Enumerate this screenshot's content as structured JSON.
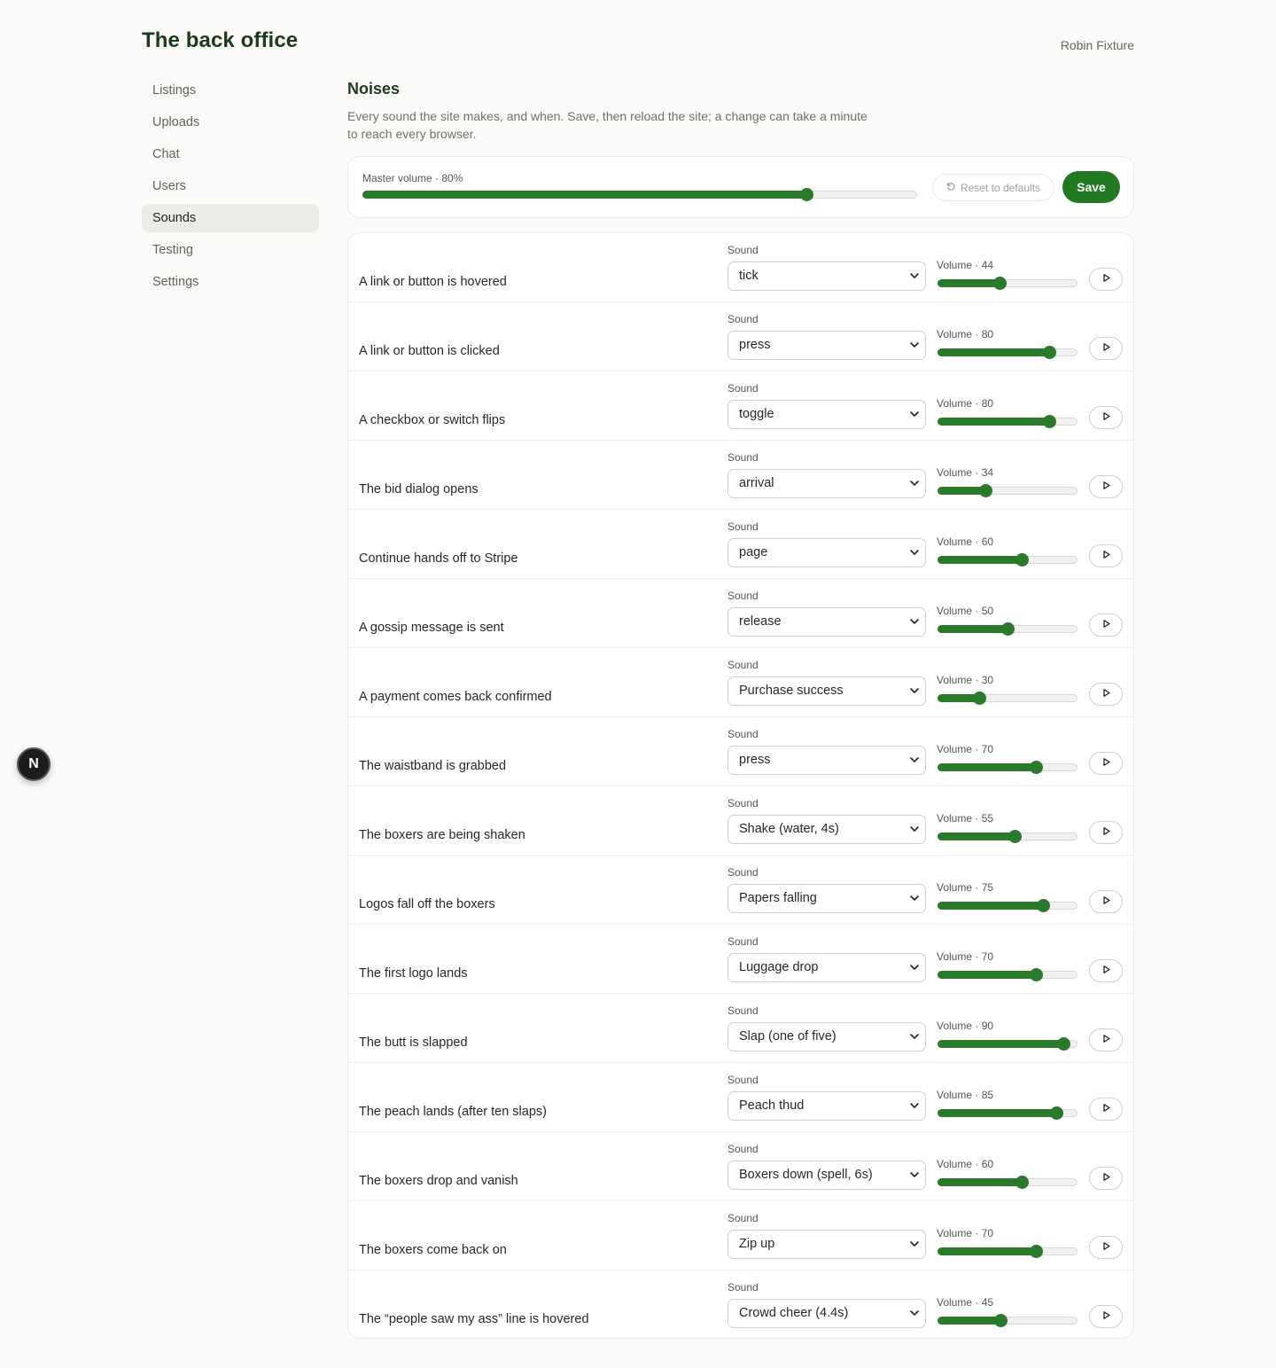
{
  "app": {
    "title": "The back office",
    "user": "Robin Fixture"
  },
  "sidebar": {
    "items": [
      {
        "label": "Listings"
      },
      {
        "label": "Uploads"
      },
      {
        "label": "Chat"
      },
      {
        "label": "Users"
      },
      {
        "label": "Sounds",
        "active": true
      },
      {
        "label": "Testing"
      },
      {
        "label": "Settings"
      }
    ]
  },
  "page": {
    "title": "Noises",
    "description": "Every sound the site makes, and when. Save, then reload the site; a change can take a minute to reach every browser."
  },
  "master": {
    "label": "Master volume · 80%",
    "value": 80
  },
  "toolbar": {
    "reset_label": "Reset to defaults",
    "save_label": "Save"
  },
  "field_labels": {
    "sound": "Sound",
    "volume_prefix": "Volume · "
  },
  "events": [
    {
      "label": "A link or button is hovered",
      "sound": "tick",
      "volume": 44
    },
    {
      "label": "A link or button is clicked",
      "sound": "press",
      "volume": 80
    },
    {
      "label": "A checkbox or switch flips",
      "sound": "toggle",
      "volume": 80
    },
    {
      "label": "The bid dialog opens",
      "sound": "arrival",
      "volume": 34
    },
    {
      "label": "Continue hands off to Stripe",
      "sound": "page",
      "volume": 60
    },
    {
      "label": "A gossip message is sent",
      "sound": "release",
      "volume": 50
    },
    {
      "label": "A payment comes back confirmed",
      "sound": "Purchase success",
      "volume": 30
    },
    {
      "label": "The waistband is grabbed",
      "sound": "press",
      "volume": 70
    },
    {
      "label": "The boxers are being shaken",
      "sound": "Shake (water, 4s)",
      "volume": 55
    },
    {
      "label": "Logos fall off the boxers",
      "sound": "Papers falling",
      "volume": 75
    },
    {
      "label": "The first logo lands",
      "sound": "Luggage drop",
      "volume": 70
    },
    {
      "label": "The butt is slapped",
      "sound": "Slap (one of five)",
      "volume": 90
    },
    {
      "label": "The peach lands (after ten slaps)",
      "sound": "Peach thud",
      "volume": 85
    },
    {
      "label": "The boxers drop and vanish",
      "sound": "Boxers down (spell, 6s)",
      "volume": 60
    },
    {
      "label": "The boxers come back on",
      "sound": "Zip up",
      "volume": 70
    },
    {
      "label": "The “people saw my ass” line is hovered",
      "sound": "Crowd cheer (4.4s)",
      "volume": 45
    }
  ],
  "badge": {
    "letter": "N"
  },
  "colors": {
    "accent": "#217a21",
    "title": "#1c3a1c"
  }
}
